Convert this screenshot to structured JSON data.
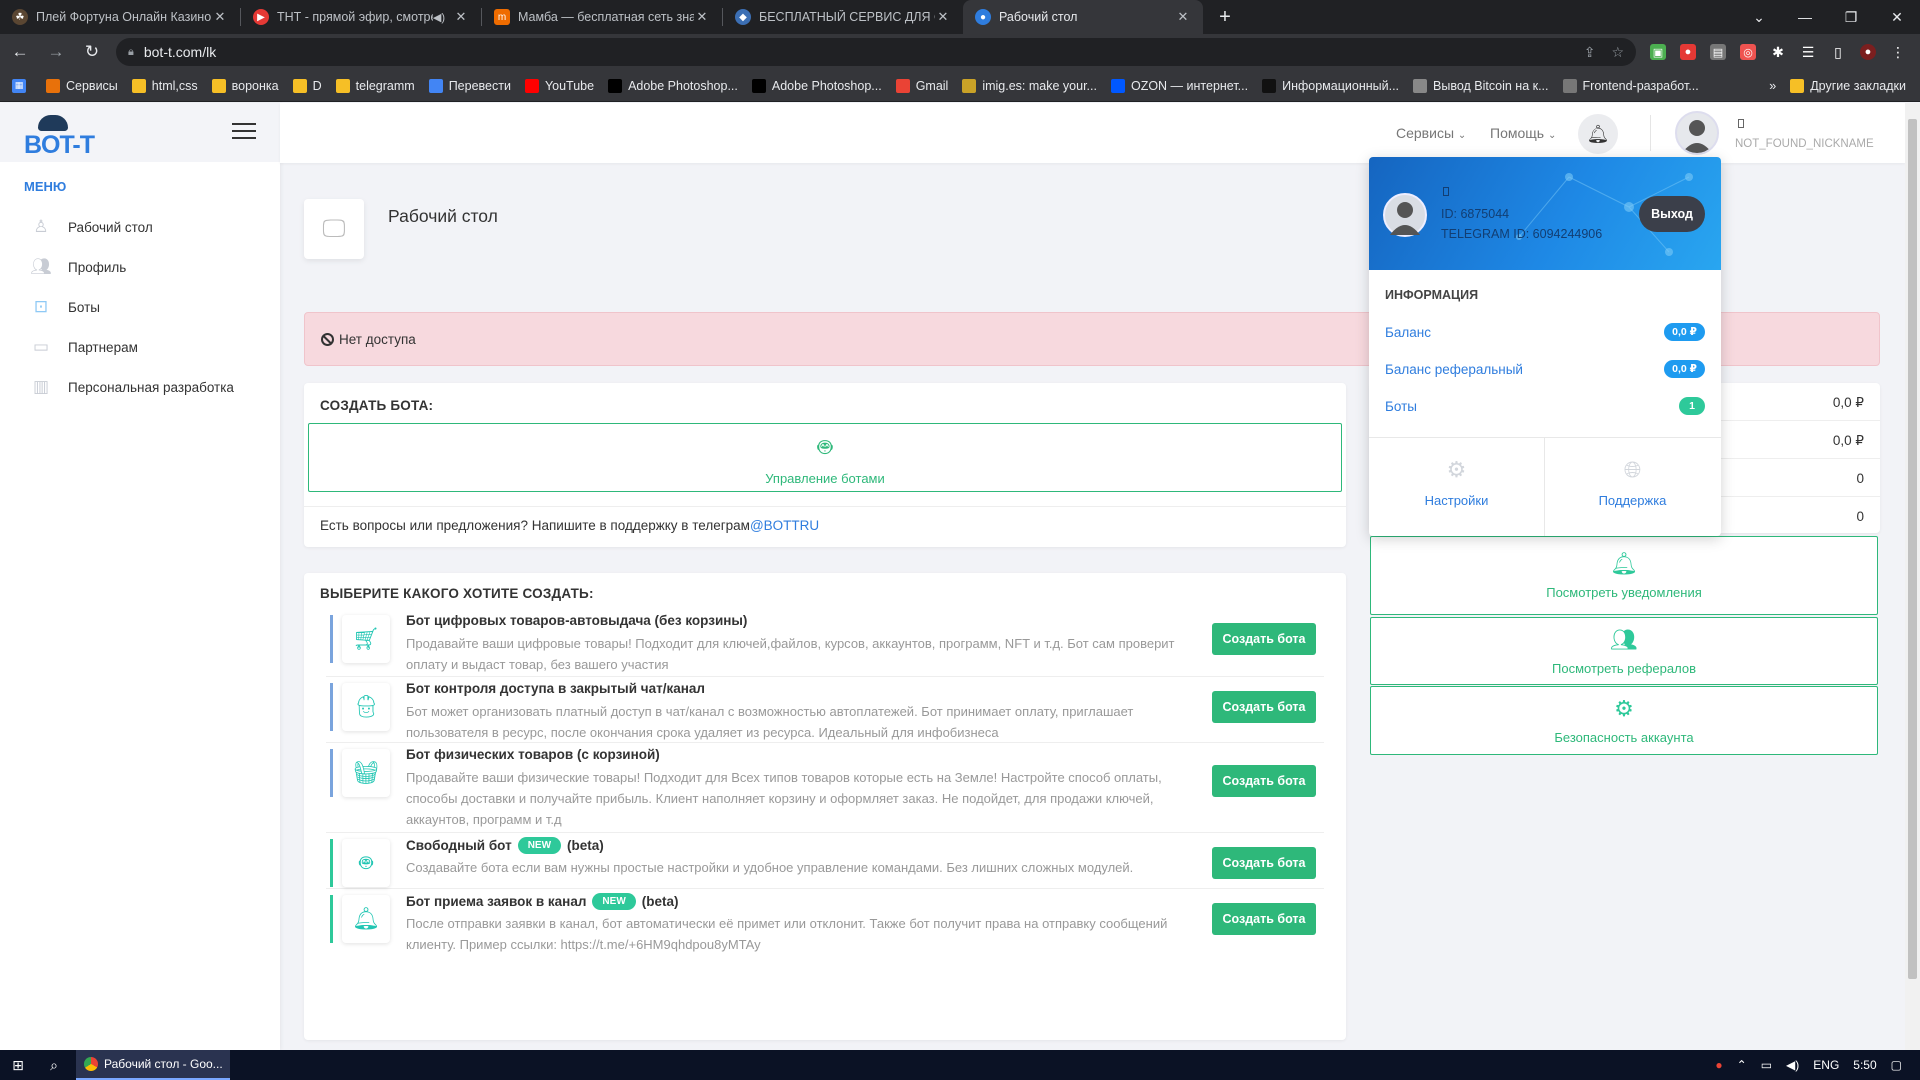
{
  "browser": {
    "tabs": [
      {
        "title": "Плей Фортуна Онлайн Казино |",
        "fav_color": "#5a4632",
        "active": false
      },
      {
        "title": "ТНТ - прямой эфир, смотре",
        "fav_color": "#e53935",
        "active": false,
        "audio": true
      },
      {
        "title": "Мамба — бесплатная сеть знак",
        "fav_color": "#ef6c00",
        "active": false
      },
      {
        "title": "БЕСПЛАТНЫЙ СЕРВИС ДЛЯ СО",
        "fav_color": "#3c6fb4",
        "active": false
      },
      {
        "title": "Рабочий стол",
        "fav_color": "#2f7dde",
        "active": true
      }
    ],
    "url": "bot-t.com/lk",
    "bookmarks": [
      {
        "label": "Сервисы",
        "color": "#e8710a"
      },
      {
        "label": "html,css",
        "color": "#f6bf26"
      },
      {
        "label": "воронка",
        "color": "#f6bf26"
      },
      {
        "label": "D",
        "color": "#f6bf26"
      },
      {
        "label": "telegramm",
        "color": "#f6bf26"
      },
      {
        "label": "Перевести",
        "color": "#4285f4"
      },
      {
        "label": "YouTube",
        "color": "#ff0000"
      },
      {
        "label": "Adobe Photoshop...",
        "color": "#000000"
      },
      {
        "label": "Adobe Photoshop...",
        "color": "#000000"
      },
      {
        "label": "Gmail",
        "color": "#ea4335"
      },
      {
        "label": "imig.es: make your...",
        "color": "#c9a227"
      },
      {
        "label": "OZON — интернет...",
        "color": "#0058ff"
      },
      {
        "label": "Информационный...",
        "color": "#111111"
      },
      {
        "label": "Вывод Bitcoin на к...",
        "color": "#888888"
      },
      {
        "label": "Frontend-разработ...",
        "color": "#777777"
      }
    ],
    "other_bookmarks": "Другие закладки"
  },
  "sidebar": {
    "logo": "BOT-T",
    "menu_title": "МЕНЮ",
    "items": [
      {
        "label": "Рабочий стол",
        "icon": "desk-icon"
      },
      {
        "label": "Профиль",
        "icon": "profile-icon"
      },
      {
        "label": "Боты",
        "icon": "robot-icon"
      },
      {
        "label": "Партнерам",
        "icon": "partner-icon"
      },
      {
        "label": "Персональная разработка",
        "icon": "building-icon"
      }
    ]
  },
  "header": {
    "services": "Сервисы",
    "help": "Помощь",
    "nickname": "NOT_FOUND_NICKNAME"
  },
  "page": {
    "title": "Рабочий стол",
    "alert": "Нет доступа"
  },
  "create": {
    "heading": "СОЗДАТЬ БОТА:",
    "manage_label": "Управление ботами",
    "support_text": "Есть вопросы или предложения? Напишите в поддержку в телеграм",
    "support_link": "@BOTTRU"
  },
  "choose": {
    "heading": "ВЫБЕРИТЕ КАКОГО ХОТИТЕ СОЗДАТЬ:",
    "button_label": "Создать бота",
    "new_badge": "NEW",
    "bots": [
      {
        "title": "Бот цифровых товаров-автовыдача (без корзины)",
        "desc": "Продавайте ваши цифровые товары! Подходит для ключей,файлов, курсов, аккаунтов, программ, NFT и т.д. Бот сам проверит оплату и выдаст товар, без вашего участия",
        "bar": "#7aa4dd"
      },
      {
        "title": "Бот контроля доступа в закрытый чат/канал",
        "desc": "Бот может организовать платный доступ в чат/канал с возможностью автоплатежей. Бот принимает оплату, приглашает пользователя в ресурс, после окончания срока удаляет из ресурса. Идеальный для инфобизнеса",
        "bar": "#7aa4dd"
      },
      {
        "title": "Бот физических товаров (с корзиной)",
        "desc": "Продавайте ваши физические товары! Подходит для Всех типов товаров которые есть на Земле! Настройте способ оплаты, способы доставки и получайте прибыль. Клиент наполняет корзину и оформляет заказ. Не подойдет, для продажи ключей, аккаунтов, программ и т.д",
        "bar": "#7aa4dd"
      },
      {
        "title": "Свободный бот",
        "suffix": "(beta)",
        "new": true,
        "desc": "Создавайте бота если вам нужны простые настройки и удобное управление командами. Без лишних сложных модулей.",
        "bar": "#2ec99a"
      },
      {
        "title": "Бот приема заявок в канал",
        "suffix": "(beta)",
        "new": true,
        "desc": "После отправки заявки в канал, бот автоматически её примет или отклонит. Также бот получит права на отправку сообщений клиенту. Пример ссылки: https://t.me/+6HM9qhdpou8yMTAy",
        "bar": "#2ec99a"
      }
    ]
  },
  "stats": {
    "values": [
      "0,0 ₽",
      "0,0 ₽",
      "0",
      "0"
    ]
  },
  "actions": {
    "notifications": "Посмотреть уведомления",
    "referrals": "Посмотреть рефералов",
    "security": "Безопасность аккаунта"
  },
  "dropdown": {
    "id": "ID: 6875044",
    "telegram_id": "TELEGRAM ID: 6094244906",
    "logout": "Выход",
    "info_heading": "ИНФОРМАЦИЯ",
    "rows": [
      {
        "label": "Баланс",
        "value": "0,0 ₽",
        "color": "#1e9bf0"
      },
      {
        "label": "Баланс реферальный",
        "value": "0,0 ₽",
        "color": "#1e9bf0"
      },
      {
        "label": "Боты",
        "value": "1",
        "color": "#2ec99a"
      }
    ],
    "settings": "Настройки",
    "support": "Поддержка"
  },
  "taskbar": {
    "app": "Рабочий стол - Goo...",
    "lang": "ENG",
    "time": "5:50"
  }
}
